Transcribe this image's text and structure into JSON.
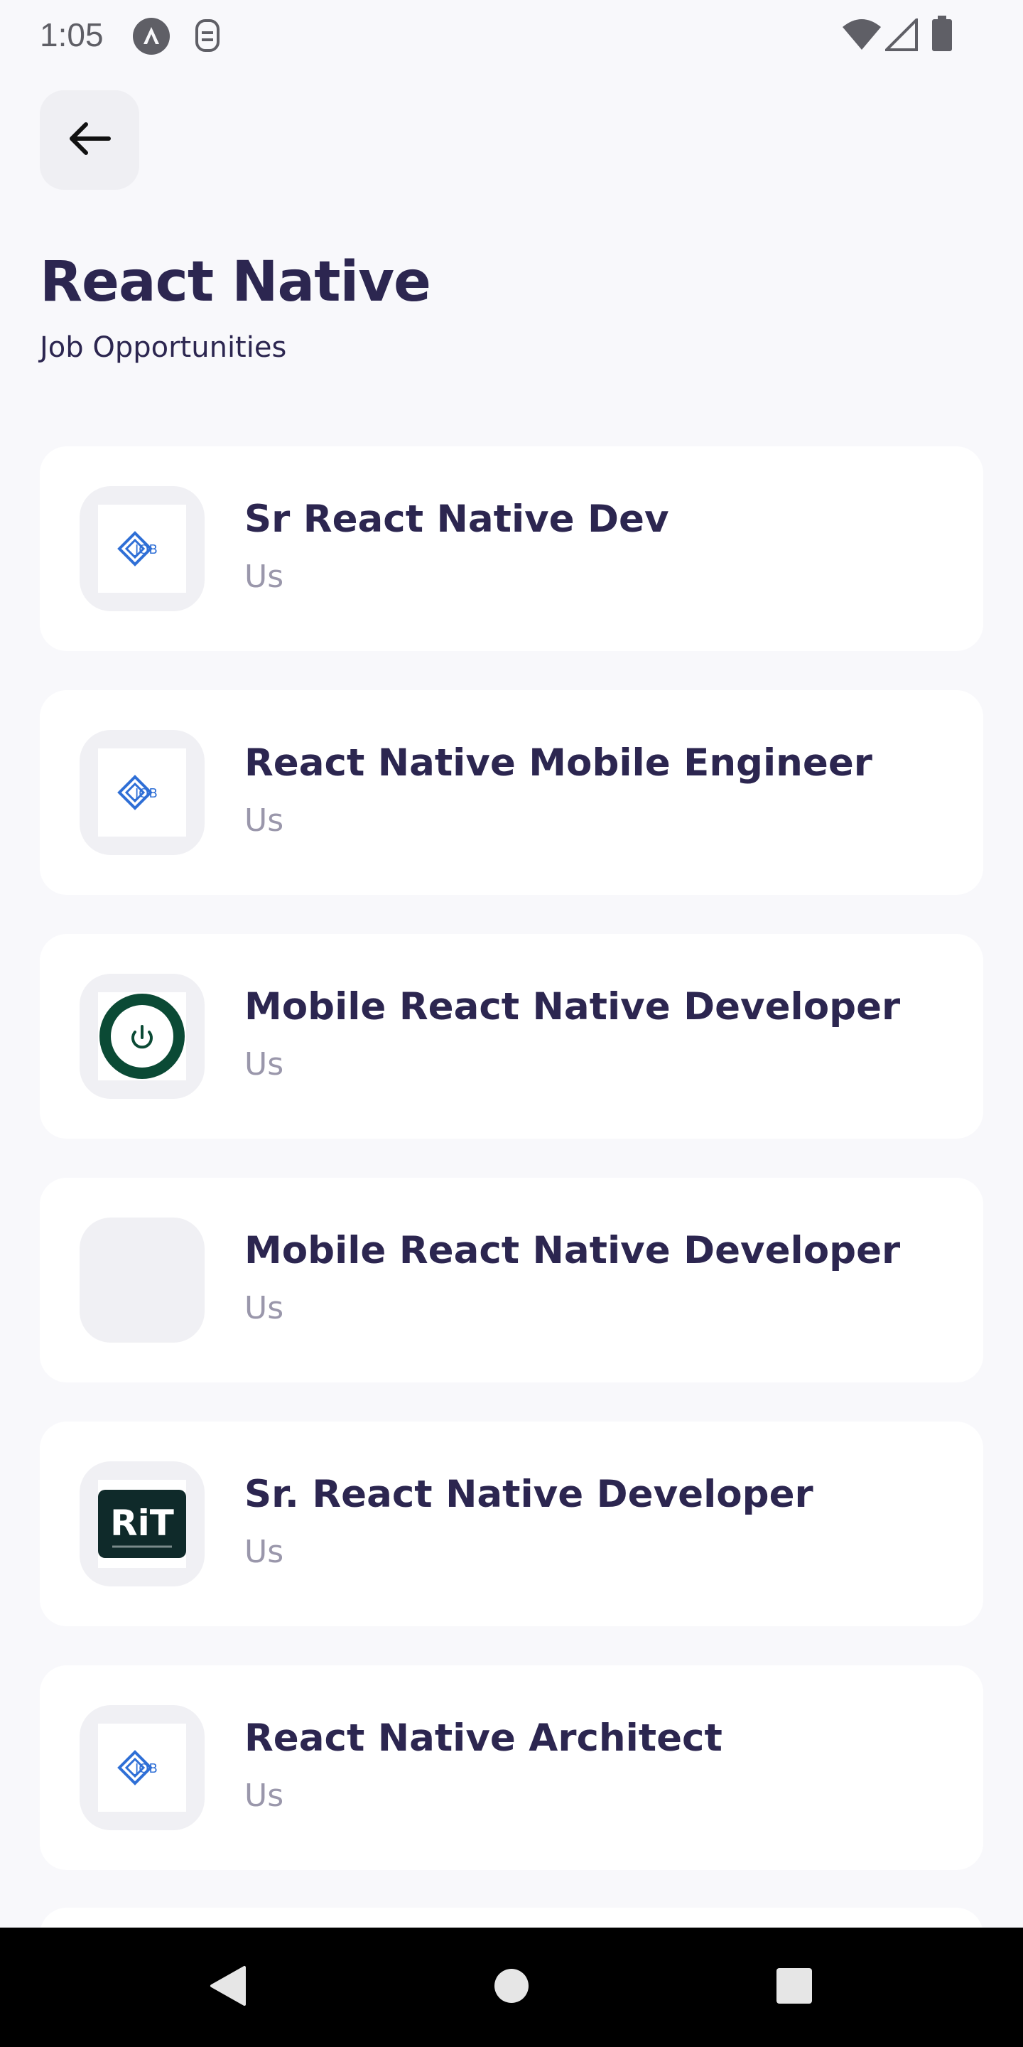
{
  "status_bar": {
    "time": "1:05",
    "left_icons": [
      "app-logo-icon",
      "sim-card-icon"
    ],
    "right_icons": [
      "wifi-icon",
      "cell-signal-icon",
      "battery-icon"
    ]
  },
  "header": {
    "back_icon": "arrow-left-icon",
    "title": "React Native",
    "subtitle": "Job Opportunities"
  },
  "jobs": [
    {
      "title": "Sr React Native Dev",
      "location": "Us",
      "logo": "job-logo"
    },
    {
      "title": "React Native Mobile Engineer",
      "location": "Us",
      "logo": "job-logo"
    },
    {
      "title": "Mobile React Native Developer",
      "location": "Us",
      "logo": "power-logo"
    },
    {
      "title": "Mobile React Native Developer",
      "location": "Us",
      "logo": "none"
    },
    {
      "title": "Sr. React Native Developer",
      "location": "Us",
      "logo": "rit-logo"
    },
    {
      "title": "React Native Architect",
      "location": "Us",
      "logo": "job-logo"
    }
  ],
  "logo_text": {
    "job": "JOB",
    "rit": "RiT"
  },
  "colors": {
    "title": "#2c2650",
    "muted": "#9a97ab",
    "background": "#f8f8fb",
    "card": "#ffffff",
    "job_logo_blue": "#2f6fd6",
    "power_logo_green": "#0b4a35"
  },
  "nav_bar": {
    "buttons": [
      "back-triangle-icon",
      "home-circle-icon",
      "recents-square-icon"
    ]
  }
}
